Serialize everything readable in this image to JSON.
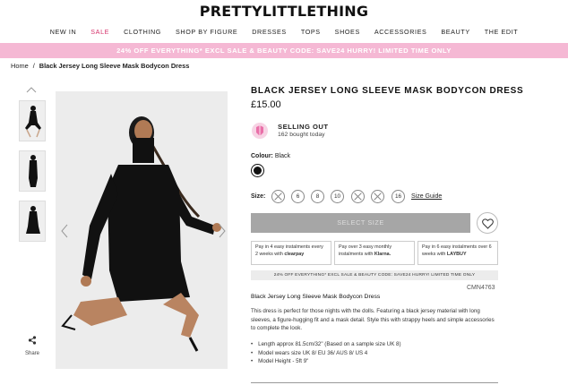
{
  "header": {
    "logo": "PRETTYLITTLETHING",
    "nav": [
      {
        "label": "NEW IN",
        "key": "new-in"
      },
      {
        "label": "SALE",
        "key": "sale"
      },
      {
        "label": "CLOTHING",
        "key": "clothing"
      },
      {
        "label": "SHOP BY FIGURE",
        "key": "shop-by-figure"
      },
      {
        "label": "DRESSES",
        "key": "dresses"
      },
      {
        "label": "TOPS",
        "key": "tops"
      },
      {
        "label": "SHOES",
        "key": "shoes"
      },
      {
        "label": "ACCESSORIES",
        "key": "accessories"
      },
      {
        "label": "BEAUTY",
        "key": "beauty"
      },
      {
        "label": "THE EDIT",
        "key": "the-edit"
      }
    ],
    "promo_banner": "24% OFF EVERYTHING* EXCL SALE & BEAUTY CODE: SAVE24 HURRY! LIMITED TIME ONLY"
  },
  "breadcrumb": {
    "home": "Home",
    "separator": "/",
    "current": "Black Jersey Long Sleeve Mask Bodycon Dress"
  },
  "gallery": {
    "share_label": "Share"
  },
  "product": {
    "title": "BLACK JERSEY LONG SLEEVE MASK BODYCON DRESS",
    "price": "£15.00",
    "selling_out": "SELLING OUT",
    "bought_today": "162 bought today",
    "colour_label": "Colour:",
    "colour_value": "Black",
    "size_label": "Size:",
    "sizes": [
      {
        "label": "",
        "available": false
      },
      {
        "label": "6",
        "available": true
      },
      {
        "label": "8",
        "available": true
      },
      {
        "label": "10",
        "available": true
      },
      {
        "label": "",
        "available": false
      },
      {
        "label": "",
        "available": false
      },
      {
        "label": "16",
        "available": true
      }
    ],
    "size_guide": "Size Guide",
    "select_size": "SELECT SIZE",
    "payments": [
      {
        "text": "Pay in 4 easy instalments every 2 weeks with",
        "brand": "clearpay"
      },
      {
        "text": "Pay over 3 easy monthly instalments with",
        "brand": "Klarna."
      },
      {
        "text": "Pay in 6 easy instalments over 6 weeks with",
        "brand": "LAYBUY"
      }
    ],
    "promo_small": "24% OFF EVERYTHING* EXCL SALE & BEAUTY CODE: SAVE24 HURRY! LIMITED TIME ONLY",
    "product_code": "CMN4763",
    "description_title": "Black Jersey Long Sleeve Mask Bodycon Dress",
    "description": "This dress is perfect for those nights with the dolls. Featuring a black jersey material with long sleeves, a figure-hugging fit and a mask detail. Style this with strappy heels and simple accessories to complete the look.",
    "details": [
      "Length approx 81.5cm/32\" (Based on a sample size UK 8)",
      "Model wears size UK 8/ EU 36/ AUS 8/ US 4",
      "Model Height - 5ft 9\""
    ]
  },
  "colors": {
    "promo_bg": "#f5b8d4",
    "sale_text": "#d6336c",
    "button_bg": "#a6a6a6",
    "dress": "#111111"
  }
}
